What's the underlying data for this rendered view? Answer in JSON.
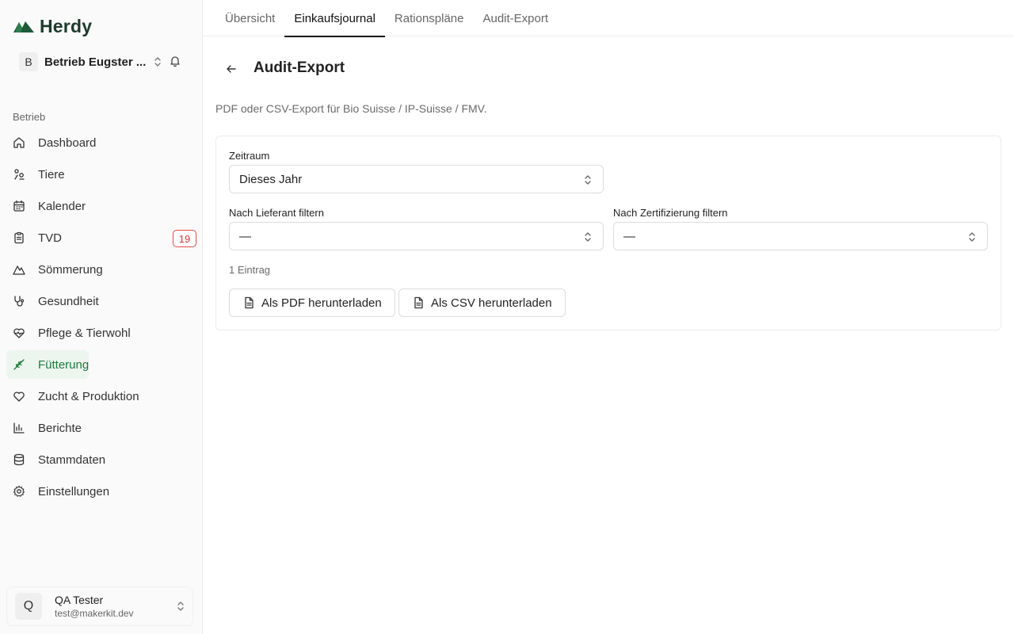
{
  "app": {
    "name": "Herdy",
    "brand_color": "#1e3a2c",
    "accent": "#1c7a3f",
    "badge_color": "#d23a3a"
  },
  "org": {
    "initial": "B",
    "name": "Betrieb Eugster ..."
  },
  "sidebar": {
    "heading": "Betrieb",
    "items": [
      {
        "label": "Dashboard",
        "icon": "home-icon"
      },
      {
        "label": "Tiere",
        "icon": "animals-icon"
      },
      {
        "label": "Kalender",
        "icon": "calendar-icon"
      },
      {
        "label": "TVD",
        "icon": "clipboard-icon",
        "badge": "19"
      },
      {
        "label": "Sömmerung",
        "icon": "mountain-icon"
      },
      {
        "label": "Gesundheit",
        "icon": "stethoscope-icon"
      },
      {
        "label": "Pflege & Tierwohl",
        "icon": "heart-pulse-icon"
      },
      {
        "label": "Fütterung",
        "icon": "wheat-icon",
        "active": true
      },
      {
        "label": "Zucht & Produktion",
        "icon": "heart-icon"
      },
      {
        "label": "Berichte",
        "icon": "bar-chart-icon"
      },
      {
        "label": "Stammdaten",
        "icon": "database-icon"
      },
      {
        "label": "Einstellungen",
        "icon": "gear-icon"
      }
    ]
  },
  "user": {
    "initial": "Q",
    "name": "QA Tester",
    "email": "test@makerkit.dev"
  },
  "tabs": [
    {
      "label": "Übersicht"
    },
    {
      "label": "Einkaufsjournal",
      "active": true
    },
    {
      "label": "Rationspläne"
    },
    {
      "label": "Audit-Export"
    }
  ],
  "page": {
    "title": "Audit-Export",
    "description": "PDF oder CSV-Export für Bio Suisse / IP-Suisse / FMV."
  },
  "form": {
    "period_label": "Zeitraum",
    "period_value": "Dieses Jahr",
    "supplier_label": "Nach Lieferant filtern",
    "supplier_value": "—",
    "cert_label": "Nach Zertifizierung filtern",
    "cert_value": "—",
    "entry_count": "1 Eintrag",
    "pdf_button": "Als PDF herunterladen",
    "csv_button": "Als CSV herunterladen"
  }
}
